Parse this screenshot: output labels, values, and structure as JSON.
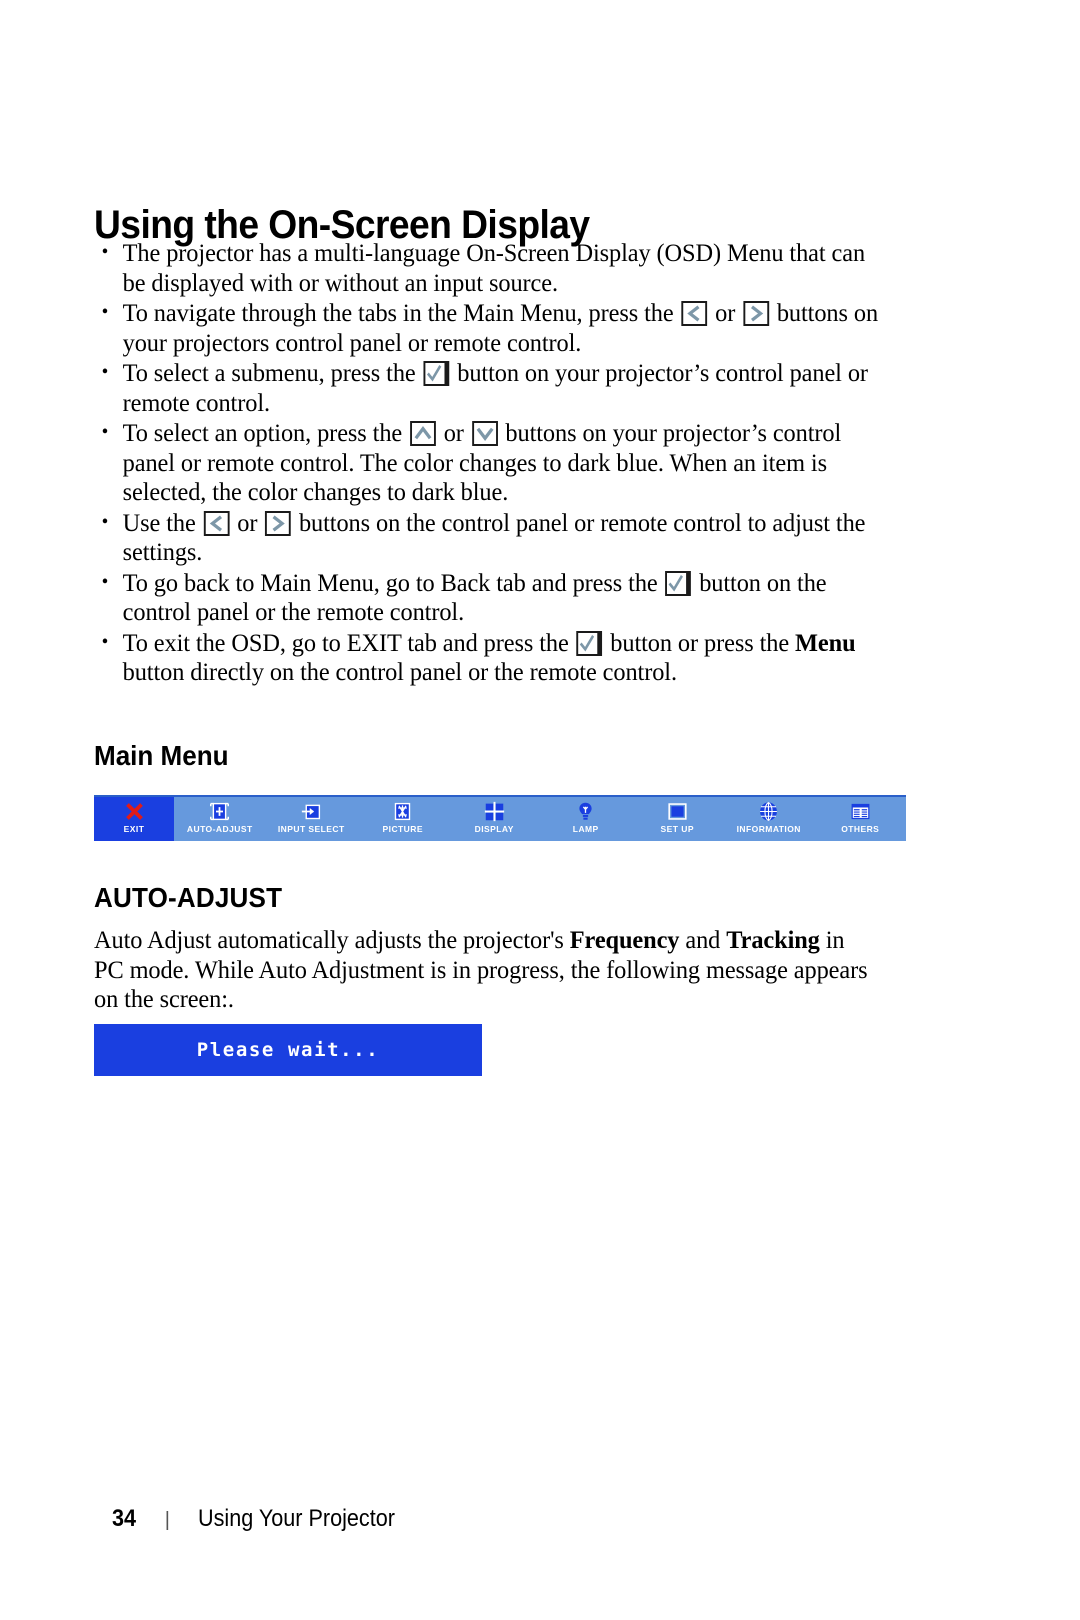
{
  "document": {
    "title": "Using the On-Screen Display"
  },
  "bullets": [
    {
      "id": "osd-multilanguage",
      "segments": [
        {
          "type": "text",
          "text": "The projector has a multi-language On-Screen Display (OSD) Menu that can be displayed with or without an input source."
        }
      ]
    },
    {
      "id": "navigate-tabs",
      "segments": [
        {
          "type": "text",
          "text": "To navigate through the tabs in the Main Menu, press the "
        },
        {
          "type": "icon",
          "icon": "left-chevron-button-icon"
        },
        {
          "type": "text",
          "text": " or "
        },
        {
          "type": "icon",
          "icon": "right-chevron-button-icon"
        },
        {
          "type": "text",
          "text": " buttons on your projectors control panel or remote control."
        }
      ]
    },
    {
      "id": "select-submenu",
      "segments": [
        {
          "type": "text",
          "text": "To select a submenu, press the "
        },
        {
          "type": "icon",
          "icon": "enter-checkmark-button-icon"
        },
        {
          "type": "text",
          "text": " button on your projector’s control panel or remote control."
        }
      ]
    },
    {
      "id": "select-option",
      "segments": [
        {
          "type": "text",
          "text": "To select an option, press the "
        },
        {
          "type": "icon",
          "icon": "up-chevron-button-icon"
        },
        {
          "type": "text",
          "text": " or "
        },
        {
          "type": "icon",
          "icon": "down-chevron-button-icon"
        },
        {
          "type": "text",
          "text": " buttons on your projector’s control panel or remote control. The color changes to dark blue. When an item is selected, the color changes to dark blue."
        }
      ]
    },
    {
      "id": "adjust-settings",
      "segments": [
        {
          "type": "text",
          "text": "Use the "
        },
        {
          "type": "icon",
          "icon": "left-chevron-button-icon"
        },
        {
          "type": "text",
          "text": " or "
        },
        {
          "type": "icon",
          "icon": "right-chevron-button-icon"
        },
        {
          "type": "text",
          "text": " buttons on the control panel or remote control to adjust the settings."
        }
      ]
    },
    {
      "id": "go-back-main-menu",
      "segments": [
        {
          "type": "text",
          "text": "To go back to Main Menu, go to Back tab and press the "
        },
        {
          "type": "icon",
          "icon": "enter-checkmark-button-icon"
        },
        {
          "type": "text",
          "text": " button on the control panel or the remote control."
        }
      ]
    },
    {
      "id": "exit-osd",
      "segments": [
        {
          "type": "text",
          "text": "To exit the OSD, go to EXIT tab and press the "
        },
        {
          "type": "icon",
          "icon": "enter-checkmark-button-icon"
        },
        {
          "type": "text",
          "text": " button or press the "
        },
        {
          "type": "bold",
          "text": "Menu"
        },
        {
          "type": "text",
          "text": " button directly on the control panel or the remote control."
        }
      ]
    }
  ],
  "sections": {
    "main_menu_heading": "Main Menu",
    "auto_adjust_heading": "AUTO-ADJUST"
  },
  "osd_menu": {
    "selected_index": 0,
    "colors": {
      "bar_background": "#6699dd",
      "selected_background": "#1a3fe0",
      "label_color": "#ffffff",
      "exit_icon_color": "#e01b18",
      "icon_color": "#1a3fe0"
    },
    "tabs": [
      {
        "label": "EXIT",
        "icon": "exit-cross-icon",
        "selected": true
      },
      {
        "label": "AUTO-ADJUST",
        "icon": "auto-adjust-icon",
        "selected": false
      },
      {
        "label": "INPUT SELECT",
        "icon": "input-select-icon",
        "selected": false
      },
      {
        "label": "PICTURE",
        "icon": "picture-icon",
        "selected": false
      },
      {
        "label": "DISPLAY",
        "icon": "display-icon",
        "selected": false
      },
      {
        "label": "LAMP",
        "icon": "lamp-bulb-icon",
        "selected": false
      },
      {
        "label": "SET UP",
        "icon": "set-up-screen-icon",
        "selected": false
      },
      {
        "label": "INFORMATION",
        "icon": "information-globe-icon",
        "selected": false
      },
      {
        "label": "OTHERS",
        "icon": "others-list-icon",
        "selected": false
      }
    ]
  },
  "auto_adjust_paragraph": {
    "part1": "Auto Adjust automatically adjusts the projector's ",
    "bold1": "Frequency",
    "part2": " and ",
    "bold2": "Tracking",
    "part3": " in PC mode. While Auto Adjustment is in progress, the following message appears on the screen:."
  },
  "wait_dialog": {
    "message": "Please wait...",
    "background_color": "#1a3fe0"
  },
  "footer": {
    "page_number": "34",
    "separator": "|",
    "section_title": "Using Your Projector"
  }
}
